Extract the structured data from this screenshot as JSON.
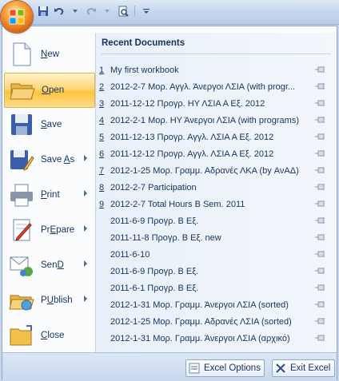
{
  "quick_access": {
    "icons": [
      "save-icon",
      "undo-icon",
      "redo-icon",
      "print-preview-icon",
      "customize-icon"
    ]
  },
  "commands": [
    {
      "label": "New",
      "underline": "N",
      "rest": "ew",
      "icon": "new-document-icon",
      "submenu": false
    },
    {
      "label": "Open",
      "underline": "O",
      "rest": "pen",
      "icon": "open-folder-icon",
      "submenu": false
    },
    {
      "label": "Save",
      "underline": "S",
      "rest": "ave",
      "icon": "save-disk-icon",
      "submenu": false
    },
    {
      "label": "Save As",
      "underline": "A",
      "pre": "Save ",
      "rest": "s",
      "icon": "save-as-icon",
      "submenu": true
    },
    {
      "label": "Print",
      "underline": "P",
      "rest": "rint",
      "icon": "printer-icon",
      "submenu": true
    },
    {
      "label": "Prepare",
      "underline": "E",
      "pre": "Pr",
      "rest": "pare",
      "icon": "prepare-icon",
      "submenu": true
    },
    {
      "label": "Send",
      "underline": "D",
      "pre": "Sen",
      "rest": "",
      "icon": "send-icon",
      "submenu": true
    },
    {
      "label": "Publish",
      "underline": "U",
      "pre": "P",
      "rest": "blish",
      "icon": "publish-icon",
      "submenu": true
    },
    {
      "label": "Close",
      "underline": "C",
      "rest": "lose",
      "icon": "close-folder-icon",
      "submenu": false
    }
  ],
  "recent": {
    "header": "Recent Documents",
    "items": [
      {
        "num": "1",
        "name": "My first workbook"
      },
      {
        "num": "2",
        "name": "2012-2-7 Μορ. Αγγλ. Άνεργοι ΛΣΙΑ (with progr..."
      },
      {
        "num": "3",
        "name": "2011-12-12 Προγρ. ΗΥ ΛΣΙΑ Α Εξ. 2012"
      },
      {
        "num": "4",
        "name": "2012-2-1 Μορ. ΗΥ Άνεργοι ΛΣΙΑ (with programs)"
      },
      {
        "num": "5",
        "name": "2011-12-13 Προγρ. Αγγλ. ΛΣΙΑ Α Εξ. 2012"
      },
      {
        "num": "6",
        "name": "2011-12-12 Προγρ. Αγγλ. ΛΣΙΑ Α Εξ. 2012"
      },
      {
        "num": "7",
        "name": "2012-1-25 Μορ. Γραμμ. Αδρανές ΛΚΑ (by ΑνΑΔ)"
      },
      {
        "num": "8",
        "name": "2012-2-7 Participation"
      },
      {
        "num": "9",
        "name": "2012-2-7 Total Hours B Sem. 2011"
      },
      {
        "num": "",
        "name": "2011-6-9 Προγρ. Β Εξ."
      },
      {
        "num": "",
        "name": "2011-11-8 Προγρ. Β Εξ. new"
      },
      {
        "num": "",
        "name": "2011-6-10"
      },
      {
        "num": "",
        "name": "2011-6-9 Προγρ. Β Εξ."
      },
      {
        "num": "",
        "name": "2011-6-1 Προγρ. Β Εξ."
      },
      {
        "num": "",
        "name": "2012-1-31 Μορ. Γραμμ. Άνεργοι ΛΣΙΑ (sorted)"
      },
      {
        "num": "",
        "name": "2012-1-25 Μορ. Γραμμ. Αδρανές ΛΣΙΑ (sorted)"
      },
      {
        "num": "",
        "name": "2012-1-31 Μορ. Γραμμ. Άνεργοι ΛΣΙΑ (αρχικό)"
      }
    ]
  },
  "footer": {
    "options_label": "Excel Options",
    "exit_label": "Exit Excel"
  },
  "colors": {
    "accent": "#ffc43d",
    "text": "#15325f",
    "panel": "#e9f0f9"
  }
}
